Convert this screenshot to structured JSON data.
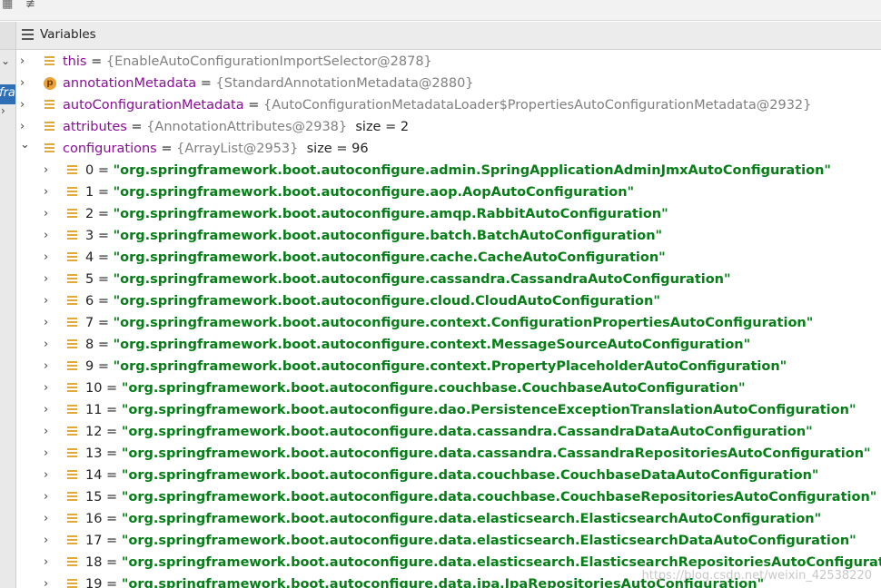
{
  "panel": {
    "title": "Variables"
  },
  "gutter": {
    "selected_glyph": "fra"
  },
  "top_vars": [
    {
      "name": "this",
      "value": "{EnableAutoConfigurationImportSelector@2878}",
      "size": "",
      "icon": "field-icon",
      "expanded": false
    },
    {
      "name": "annotationMetadata",
      "value": "{StandardAnnotationMetadata@2880}",
      "size": "",
      "icon": "p-icon",
      "expanded": false
    },
    {
      "name": "autoConfigurationMetadata",
      "value": "{AutoConfigurationMetadataLoader$PropertiesAutoConfigurationMetadata@2932}",
      "size": "",
      "icon": "field-icon",
      "expanded": false
    },
    {
      "name": "attributes",
      "value": "{AnnotationAttributes@2938}",
      "size": "size = 2",
      "icon": "field-icon",
      "expanded": false
    },
    {
      "name": "configurations",
      "value": "{ArrayList@2953}",
      "size": "size = 96",
      "icon": "field-icon",
      "expanded": true
    }
  ],
  "p_icon_letter": "p",
  "items": [
    {
      "index": "0",
      "value": "\"org.springframework.boot.autoconfigure.admin.SpringApplicationAdminJmxAutoConfiguration\""
    },
    {
      "index": "1",
      "value": "\"org.springframework.boot.autoconfigure.aop.AopAutoConfiguration\""
    },
    {
      "index": "2",
      "value": "\"org.springframework.boot.autoconfigure.amqp.RabbitAutoConfiguration\""
    },
    {
      "index": "3",
      "value": "\"org.springframework.boot.autoconfigure.batch.BatchAutoConfiguration\""
    },
    {
      "index": "4",
      "value": "\"org.springframework.boot.autoconfigure.cache.CacheAutoConfiguration\""
    },
    {
      "index": "5",
      "value": "\"org.springframework.boot.autoconfigure.cassandra.CassandraAutoConfiguration\""
    },
    {
      "index": "6",
      "value": "\"org.springframework.boot.autoconfigure.cloud.CloudAutoConfiguration\""
    },
    {
      "index": "7",
      "value": "\"org.springframework.boot.autoconfigure.context.ConfigurationPropertiesAutoConfiguration\""
    },
    {
      "index": "8",
      "value": "\"org.springframework.boot.autoconfigure.context.MessageSourceAutoConfiguration\""
    },
    {
      "index": "9",
      "value": "\"org.springframework.boot.autoconfigure.context.PropertyPlaceholderAutoConfiguration\""
    },
    {
      "index": "10",
      "value": "\"org.springframework.boot.autoconfigure.couchbase.CouchbaseAutoConfiguration\""
    },
    {
      "index": "11",
      "value": "\"org.springframework.boot.autoconfigure.dao.PersistenceExceptionTranslationAutoConfiguration\""
    },
    {
      "index": "12",
      "value": "\"org.springframework.boot.autoconfigure.data.cassandra.CassandraDataAutoConfiguration\""
    },
    {
      "index": "13",
      "value": "\"org.springframework.boot.autoconfigure.data.cassandra.CassandraRepositoriesAutoConfiguration\""
    },
    {
      "index": "14",
      "value": "\"org.springframework.boot.autoconfigure.data.couchbase.CouchbaseDataAutoConfiguration\""
    },
    {
      "index": "15",
      "value": "\"org.springframework.boot.autoconfigure.data.couchbase.CouchbaseRepositoriesAutoConfiguration\""
    },
    {
      "index": "16",
      "value": "\"org.springframework.boot.autoconfigure.data.elasticsearch.ElasticsearchAutoConfiguration\""
    },
    {
      "index": "17",
      "value": "\"org.springframework.boot.autoconfigure.data.elasticsearch.ElasticsearchDataAutoConfiguration\""
    },
    {
      "index": "18",
      "value": "\"org.springframework.boot.autoconfigure.data.elasticsearch.ElasticsearchRepositoriesAutoConfiguration\""
    },
    {
      "index": "19",
      "value": "\"org.springframework.boot.autoconfigure.data.jpa.JpaRepositoriesAutoConfiguration\""
    }
  ],
  "watermark": "https://blog.csdn.net/weixin_42538220",
  "colors": {
    "name": "#871094",
    "string": "#067d17",
    "object": "#808080",
    "field_icon": "#e1a83a",
    "selection": "#2f6fb5"
  }
}
